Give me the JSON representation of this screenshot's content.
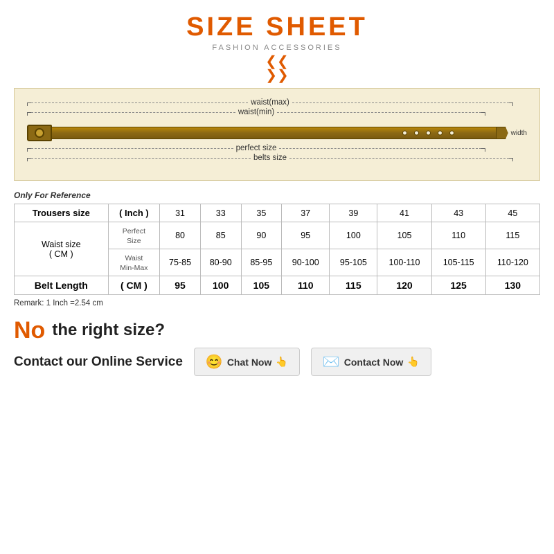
{
  "header": {
    "title": "SIZE SHEET",
    "subtitle": "FASHION ACCESSORIES"
  },
  "belt_diagram": {
    "measurements": [
      {
        "label": "waist(max)",
        "position": "top"
      },
      {
        "label": "waist(min)",
        "position": "upper"
      },
      {
        "label": "perfect size",
        "position": "lower"
      },
      {
        "label": "belts size",
        "position": "bottom"
      }
    ],
    "width_label": "width"
  },
  "reference_label": "Only For Reference",
  "table": {
    "col1_header": "Trousers size",
    "col2_header": "( Inch )",
    "sizes": [
      "31",
      "33",
      "35",
      "37",
      "39",
      "41",
      "43",
      "45"
    ],
    "waist_label": "Waist size",
    "waist_unit": "( CM )",
    "perfect_label": "Perfect Size",
    "waist_min_max_label": "Waist Min-Max",
    "perfect_values": [
      "80",
      "85",
      "90",
      "95",
      "100",
      "105",
      "110",
      "115"
    ],
    "waist_values": [
      "75-85",
      "80-90",
      "85-95",
      "90-100",
      "95-105",
      "100-110",
      "105-115",
      "110-120"
    ],
    "belt_length_label": "Belt Length",
    "belt_length_unit": "( CM )",
    "belt_length_values": [
      "95",
      "100",
      "105",
      "110",
      "115",
      "120",
      "125",
      "130"
    ]
  },
  "remark": "Remark: 1 Inch =2.54 cm",
  "bottom": {
    "no_text": "No",
    "right_size_text": "the right size?",
    "contact_label": "Contact our Online Service",
    "chat_btn": "Chat Now",
    "contact_btn": "Contact Now"
  }
}
